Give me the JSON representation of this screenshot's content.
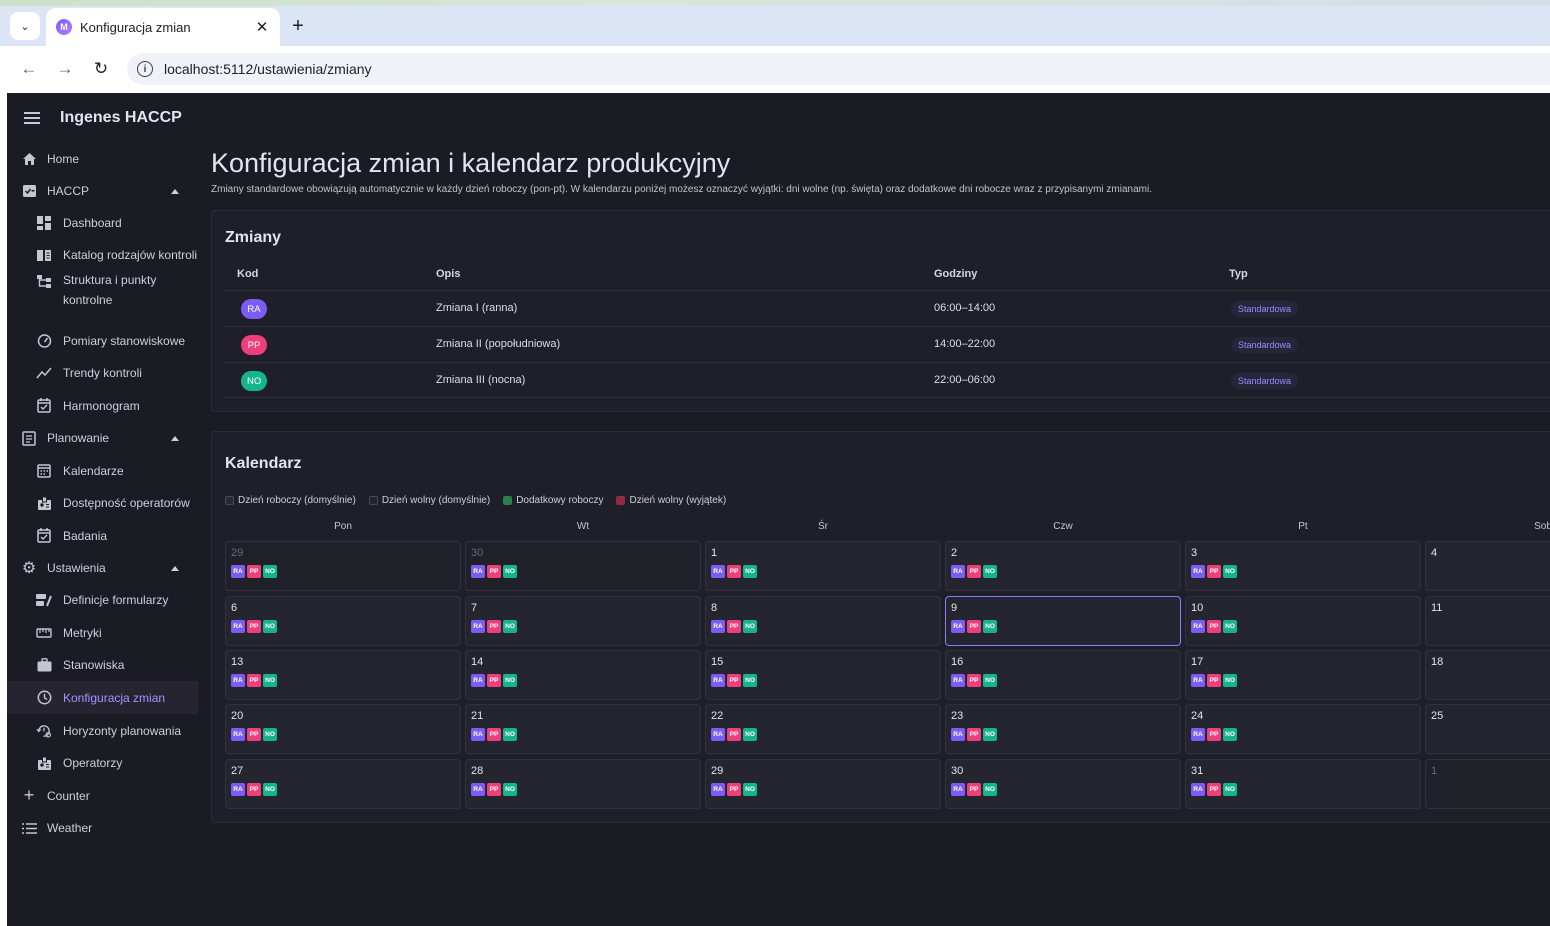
{
  "browser": {
    "tab_title": "Konfiguracja zmian",
    "tab_favicon": "M",
    "url": "localhost:5112/ustawienia/zmiany",
    "close_glyph": "✕",
    "new_tab_glyph": "+",
    "menu_glyph": "⌄"
  },
  "app": {
    "title": "Ingenes HACCP"
  },
  "sidebar": {
    "items": [
      {
        "label": "Home",
        "icon": "home-icon"
      },
      {
        "label": "HACCP",
        "icon": "checklist-icon"
      },
      {
        "label": "Dashboard",
        "icon": "dashboard-icon"
      },
      {
        "label": "Katalog rodzajów kontroli",
        "icon": "book-icon"
      },
      {
        "label": "Struktura i punkty kontrolne",
        "icon": "tree-icon"
      },
      {
        "label": "Pomiary stanowiskowe",
        "icon": "gauge-icon"
      },
      {
        "label": "Trendy kontroli",
        "icon": "trend-icon"
      },
      {
        "label": "Harmonogram",
        "icon": "calendar-check-icon"
      },
      {
        "label": "Planowanie",
        "icon": "document-icon"
      },
      {
        "label": "Kalendarze",
        "icon": "calendar-icon"
      },
      {
        "label": "Dostępność operatorów",
        "icon": "badge-icon"
      },
      {
        "label": "Badania",
        "icon": "calendar-check-icon"
      },
      {
        "label": "Ustawienia",
        "icon": "gear-icon"
      },
      {
        "label": "Definicje formularzy",
        "icon": "form-icon"
      },
      {
        "label": "Metryki",
        "icon": "ruler-icon"
      },
      {
        "label": "Stanowiska",
        "icon": "briefcase-icon"
      },
      {
        "label": "Konfiguracja zmian",
        "icon": "clock-icon"
      },
      {
        "label": "Horyzonty planowania",
        "icon": "history-gear-icon"
      },
      {
        "label": "Operatorzy",
        "icon": "badge-icon"
      },
      {
        "label": "Counter",
        "icon": "plus-icon"
      },
      {
        "label": "Weather",
        "icon": "list-icon"
      }
    ]
  },
  "page": {
    "title": "Konfiguracja zmian i kalendarz produkcyjny",
    "subtitle": "Zmiany standardowe obowiązują automatycznie w każdy dzień roboczy (pon-pt). W kalendarzu poniżej możesz oznaczyć wyjątki: dni wolne (np. święta) oraz dodatkowe dni robocze wraz z przypisanymi zmianami."
  },
  "shifts": {
    "title": "Zmiany",
    "headers": {
      "code": "Kod",
      "desc": "Opis",
      "hours": "Godziny",
      "type": "Typ"
    },
    "rows": [
      {
        "code": "RA",
        "desc": "Zmiana I (ranna)",
        "hours": "06:00–14:00",
        "type": "Standardowa",
        "color": "#7c5cf6"
      },
      {
        "code": "PP",
        "desc": "Zmiana II (popołudniowa)",
        "hours": "14:00–22:00",
        "type": "Standardowa",
        "color": "#ef3f7a"
      },
      {
        "code": "NO",
        "desc": "Zmiana III (nocna)",
        "hours": "22:00–06:00",
        "type": "Standardowa",
        "color": "#16b48d"
      }
    ]
  },
  "calendar": {
    "title": "Kalendarz",
    "legend": [
      {
        "label": "Dzień roboczy (domyślnie)",
        "color": "#2a2a34"
      },
      {
        "label": "Dzień wolny (domyślnie)",
        "color": "#23232b"
      },
      {
        "label": "Dodatkowy roboczy",
        "color": "#2e7d4f"
      },
      {
        "label": "Dzień wolny (wyjątek)",
        "color": "#8f2b44"
      }
    ],
    "weekdays": [
      "Pon",
      "Wt",
      "Śr",
      "Czw",
      "Pt",
      "Sob"
    ],
    "shift_codes": [
      "RA",
      "PP",
      "NO"
    ],
    "weeks": [
      [
        {
          "day": "29",
          "outside": true,
          "shifts": true
        },
        {
          "day": "30",
          "outside": true,
          "shifts": true
        },
        {
          "day": "1",
          "shifts": true
        },
        {
          "day": "2",
          "shifts": true
        },
        {
          "day": "3",
          "shifts": true
        },
        {
          "day": "4",
          "shifts": false
        }
      ],
      [
        {
          "day": "6",
          "shifts": true
        },
        {
          "day": "7",
          "shifts": true
        },
        {
          "day": "8",
          "shifts": true
        },
        {
          "day": "9",
          "shifts": true,
          "today": true
        },
        {
          "day": "10",
          "shifts": true
        },
        {
          "day": "11",
          "shifts": false
        }
      ],
      [
        {
          "day": "13",
          "shifts": true
        },
        {
          "day": "14",
          "shifts": true
        },
        {
          "day": "15",
          "shifts": true
        },
        {
          "day": "16",
          "shifts": true
        },
        {
          "day": "17",
          "shifts": true
        },
        {
          "day": "18",
          "shifts": false
        }
      ],
      [
        {
          "day": "20",
          "shifts": true
        },
        {
          "day": "21",
          "shifts": true
        },
        {
          "day": "22",
          "shifts": true
        },
        {
          "day": "23",
          "shifts": true
        },
        {
          "day": "24",
          "shifts": true
        },
        {
          "day": "25",
          "shifts": false
        }
      ],
      [
        {
          "day": "27",
          "shifts": true
        },
        {
          "day": "28",
          "shifts": true
        },
        {
          "day": "29",
          "shifts": true
        },
        {
          "day": "30",
          "shifts": true
        },
        {
          "day": "31",
          "shifts": true
        },
        {
          "day": "1",
          "outside": true,
          "shifts": false
        }
      ]
    ]
  },
  "colors": {
    "accent": "#a593ff",
    "app_bg": "#1b1b24",
    "card_bg": "#1f1f29"
  }
}
